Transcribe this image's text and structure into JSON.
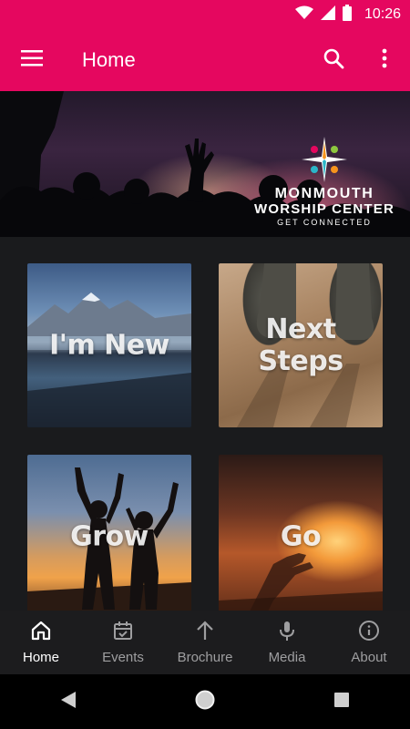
{
  "status_bar": {
    "time": "10:26",
    "icons": [
      "wifi-icon",
      "signal-icon",
      "battery-icon"
    ]
  },
  "app_bar": {
    "title": "Home",
    "icons": [
      "menu-icon",
      "search-icon",
      "more-vert-icon"
    ]
  },
  "hero": {
    "logo_line1": "MONMOUTH",
    "logo_line2": "WORSHIP CENTER",
    "logo_tagline": "GET CONNECTED"
  },
  "tiles": [
    {
      "label": "I'm New"
    },
    {
      "label": "Next Steps"
    },
    {
      "label": "Grow"
    },
    {
      "label": "Go"
    }
  ],
  "bottom_nav": {
    "active": "Home",
    "items": [
      {
        "label": "Home",
        "icon": "home-icon"
      },
      {
        "label": "Events",
        "icon": "calendar-icon"
      },
      {
        "label": "Brochure",
        "icon": "arrow-up-icon"
      },
      {
        "label": "Media",
        "icon": "microphone-icon"
      },
      {
        "label": "About",
        "icon": "info-icon"
      }
    ]
  },
  "system_nav": {
    "icons": [
      "back-icon",
      "home-circle-icon",
      "recents-icon"
    ]
  },
  "colors": {
    "brand": "#e5075f",
    "nav_background": "#1c1c1e",
    "inactive": "#9e9ea0"
  }
}
